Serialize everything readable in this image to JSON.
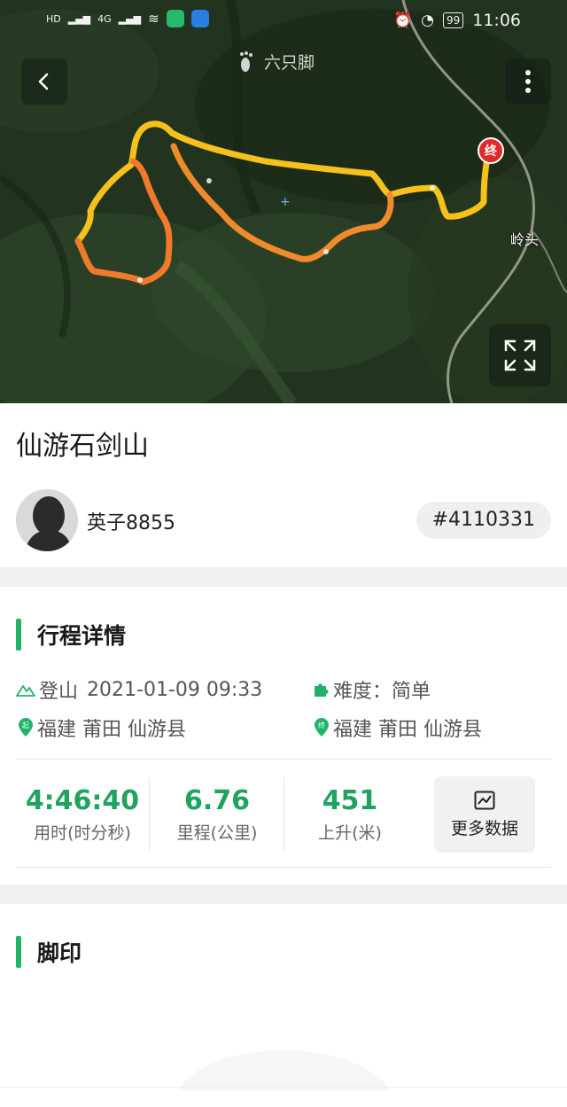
{
  "status_bar": {
    "time": "11:06",
    "battery": "99",
    "network_labels": [
      "HD",
      "4G",
      "4G"
    ]
  },
  "map": {
    "brand": "六只脚",
    "end_marker": "终",
    "place_label": "岭头"
  },
  "trip": {
    "title": "仙游石剑山",
    "user": {
      "name": "英子8855"
    },
    "id": "#4110331"
  },
  "details": {
    "section_title": "行程详情",
    "activity": "登山",
    "datetime": "2021-01-09 09:33",
    "difficulty": "难度：简单",
    "start_location": "福建 莆田 仙游县",
    "end_location": "福建 莆田 仙游县",
    "stats": [
      {
        "value": "4:46:40",
        "label": "用时(时分秒)"
      },
      {
        "value": "6.76",
        "label": "里程(公里)"
      },
      {
        "value": "451",
        "label": "上升(米)"
      }
    ],
    "more_data_label": "更多数据"
  },
  "footprint": {
    "section_title": "脚印"
  },
  "colors": {
    "accent": "#1fb46a",
    "stat_value": "#1fa35f",
    "track_start": "#f07a2a",
    "track_end": "#f5c11a",
    "end_marker": "#e22a2a"
  }
}
